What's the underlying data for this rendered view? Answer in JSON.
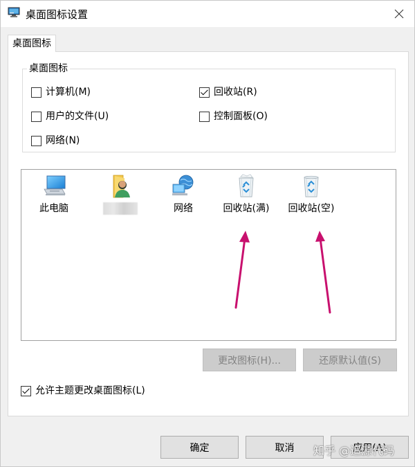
{
  "window": {
    "title": "桌面图标设置"
  },
  "tabs": [
    {
      "label": "桌面图标"
    }
  ],
  "group": {
    "legend": "桌面图标",
    "checkboxes": [
      {
        "label": "计算机(M)",
        "checked": false
      },
      {
        "label": "回收站(R)",
        "checked": true
      },
      {
        "label": "用户的文件(U)",
        "checked": false
      },
      {
        "label": "控制面板(O)",
        "checked": false
      },
      {
        "label": "网络(N)",
        "checked": false
      }
    ]
  },
  "icons": [
    {
      "label": "此电脑",
      "icon": "computer-icon"
    },
    {
      "label": "",
      "icon": "user-folder-icon"
    },
    {
      "label": "网络",
      "icon": "network-icon"
    },
    {
      "label": "回收站(满)",
      "icon": "recycle-bin-full-icon"
    },
    {
      "label": "回收站(空)",
      "icon": "recycle-bin-empty-icon"
    }
  ],
  "actions": {
    "change_icon": "更改图标(H)...",
    "restore_default": "还原默认值(S)"
  },
  "theme_checkbox": {
    "label": "允许主题更改桌面图标(L)",
    "checked": true
  },
  "footer": {
    "ok": "确定",
    "cancel": "取消",
    "apply": "应用(A)"
  },
  "watermark": "知乎 @追源代码",
  "colors": {
    "annotation_arrow": "#c8106e",
    "disabled_button": "#cccccc"
  }
}
